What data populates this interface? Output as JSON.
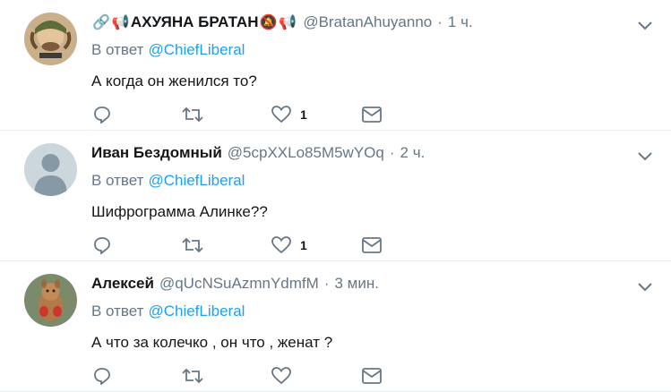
{
  "tweets": [
    {
      "name": "🔗📢АХУЯНА БРАТАН🔕📢",
      "name_text": "АХУЯНА БРАТАН",
      "handle": "@BratanAhuyanno",
      "dot": "·",
      "time": "1 ч.",
      "reply_prefix": "В ответ",
      "reply_to": "@ChiefLiberal",
      "text": "А когда он женился то?",
      "likes": "1"
    },
    {
      "name": "Иван Бездомный",
      "handle": "@5cpXXLo85M5wYOq",
      "dot": "·",
      "time": "2 ч.",
      "reply_prefix": "В ответ",
      "reply_to": "@ChiefLiberal",
      "text": "Шифрограмма Алинке??",
      "likes": "1"
    },
    {
      "name": "Алексей",
      "handle": "@qUcNSuAzmnYdmfM",
      "dot": "·",
      "time": "3 мин.",
      "reply_prefix": "В ответ",
      "reply_to": "@ChiefLiberal",
      "text": "А что за колечко , он что , женат ?",
      "likes": ""
    }
  ],
  "colors": {
    "accent": "#1da1f2",
    "muted": "#657786",
    "text": "#14171a",
    "divider": "#e6ecf0"
  }
}
